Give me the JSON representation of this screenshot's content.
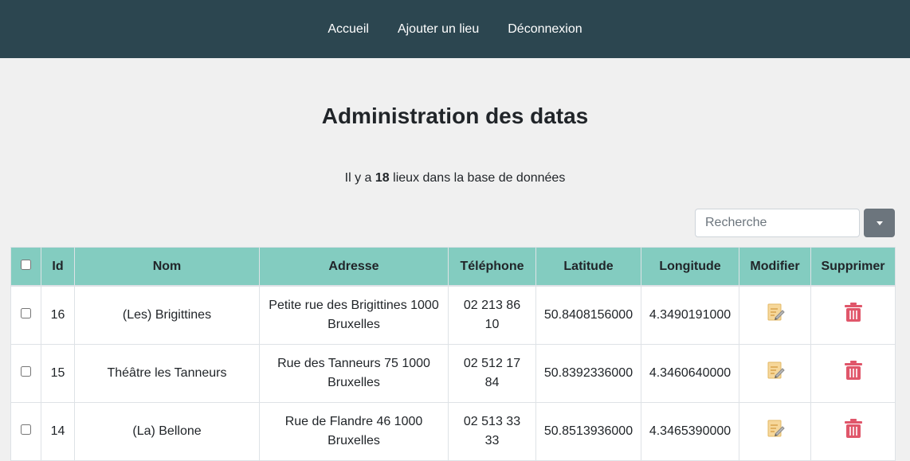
{
  "nav": {
    "items": [
      "Accueil",
      "Ajouter un lieu",
      "Déconnexion"
    ]
  },
  "page": {
    "title": "Administration des datas",
    "count_prefix": "Il y a",
    "count_value": "18",
    "count_suffix": "lieux dans la base de données"
  },
  "search": {
    "placeholder": "Recherche"
  },
  "table": {
    "headers": [
      "Id",
      "Nom",
      "Adresse",
      "Téléphone",
      "Latitude",
      "Longitude",
      "Modifier",
      "Supprimer"
    ],
    "rows": [
      {
        "id": "16",
        "nom": "(Les) Brigittines",
        "adresse": "Petite rue des Brigittines 1000 Bruxelles",
        "telephone": "02 213 86 10",
        "latitude": "50.8408156000",
        "longitude": "4.3490191000"
      },
      {
        "id": "15",
        "nom": "Théâtre les Tanneurs",
        "adresse": "Rue des Tanneurs 75 1000 Bruxelles",
        "telephone": "02 512 17 84",
        "latitude": "50.8392336000",
        "longitude": "4.3460640000"
      },
      {
        "id": "14",
        "nom": "(La) Bellone",
        "adresse": "Rue de Flandre 46 1000 Bruxelles",
        "telephone": "02 513 33 33",
        "latitude": "50.8513936000",
        "longitude": "4.3465390000"
      }
    ]
  },
  "colors": {
    "navbar": "#2c4650",
    "table_header": "#83ccc0",
    "delete_icon": "#e0566a",
    "edit_icon": "#f2c97a"
  },
  "icons": {
    "edit": "edit-note-icon",
    "delete": "trash-icon"
  }
}
